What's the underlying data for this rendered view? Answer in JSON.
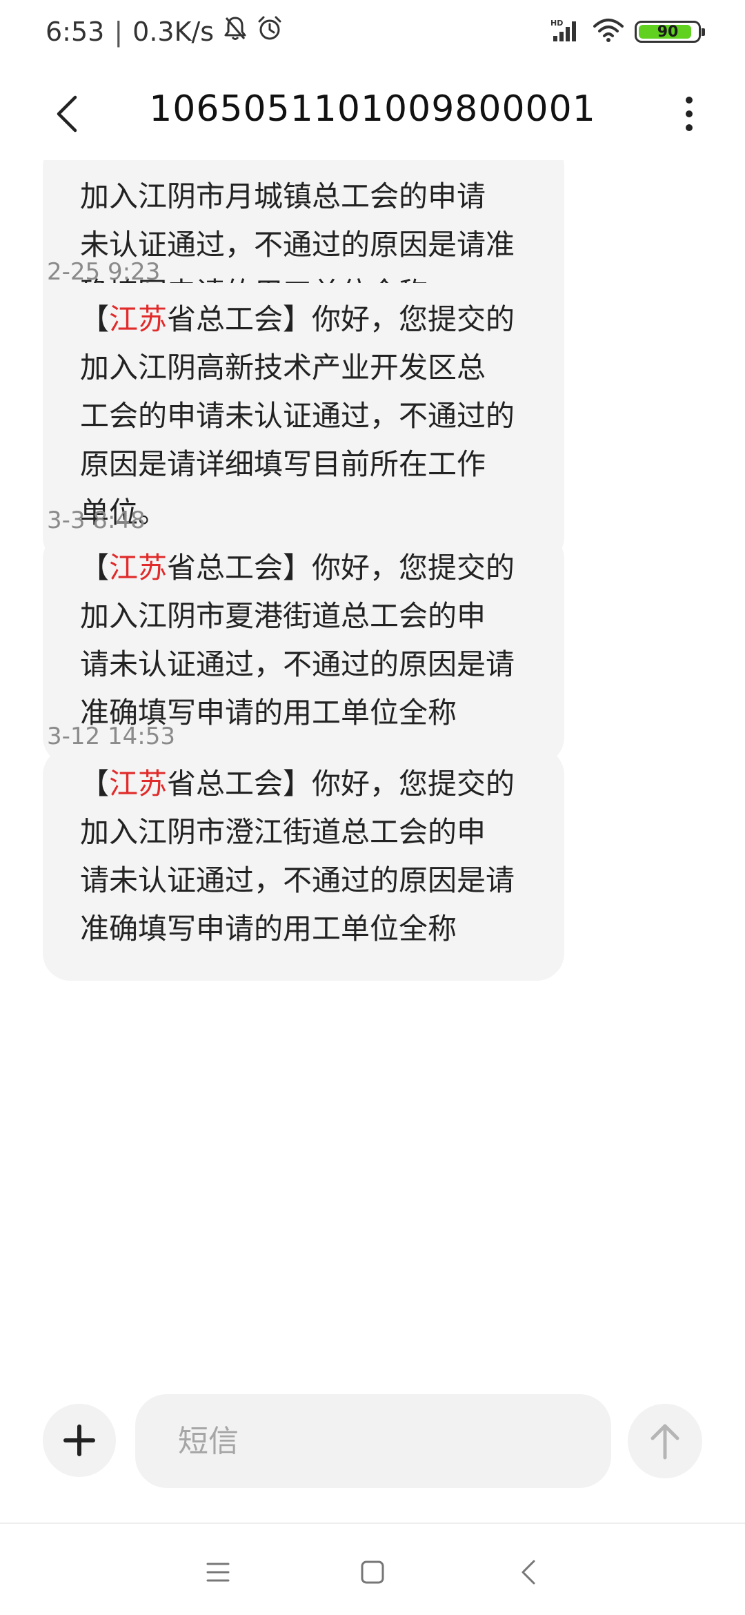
{
  "status_bar": {
    "time": "6:53",
    "separator": "|",
    "net_speed": "0.3K/s",
    "icons": [
      "bell-off-icon",
      "alarm-icon",
      "hd-signal-icon",
      "wifi-icon",
      "battery-icon"
    ],
    "network_badge": "HD",
    "battery": {
      "level": 90,
      "label": "90",
      "color": "#5fd11e"
    }
  },
  "header": {
    "back_icon": "chevron-left-icon",
    "title": "1065051101009800001",
    "more_icon": "more-vertical-icon"
  },
  "colors": {
    "bubble_bg": "#f4f4f4",
    "highlight": "#e12a2a",
    "timestamp": "#8a8a8a"
  },
  "messages": [
    {
      "timestamp": "",
      "lines": [
        [
          {
            "t": "加入江阴市月城镇总工会的申请"
          }
        ],
        [
          {
            "t": "未认证通过，不通过的原因是请准"
          }
        ],
        [
          {
            "t": "确填写申请的用工单位全称"
          }
        ]
      ]
    },
    {
      "timestamp": "2-25 9:23",
      "lines": [
        [
          {
            "t": "【"
          },
          {
            "t": "江苏",
            "hl": true
          },
          {
            "t": "省总工会】你好，您提交的"
          }
        ],
        [
          {
            "t": "加入江阴高新技术产业开发区总"
          }
        ],
        [
          {
            "t": "工会的申请未认证通过，不通过的"
          }
        ],
        [
          {
            "t": "原因是请详细填写目前所在工作"
          }
        ],
        [
          {
            "t": "单位。"
          }
        ]
      ]
    },
    {
      "timestamp": "3-3 8:48",
      "lines": [
        [
          {
            "t": "【"
          },
          {
            "t": "江苏",
            "hl": true
          },
          {
            "t": "省总工会】你好，您提交的"
          }
        ],
        [
          {
            "t": "加入江阴市夏港街道总工会的申"
          }
        ],
        [
          {
            "t": "请未认证通过，不通过的原因是请"
          }
        ],
        [
          {
            "t": "准确填写申请的用工单位全称"
          }
        ]
      ]
    },
    {
      "timestamp": "3-12 14:53",
      "lines": [
        [
          {
            "t": "【"
          },
          {
            "t": "江苏",
            "hl": true
          },
          {
            "t": "省总工会】你好，您提交的"
          }
        ],
        [
          {
            "t": "加入江阴市澄江街道总工会的申"
          }
        ],
        [
          {
            "t": "请未认证通过，不通过的原因是请"
          }
        ],
        [
          {
            "t": "准确填写申请的用工单位全称"
          }
        ]
      ]
    }
  ],
  "composer": {
    "add_icon": "plus-icon",
    "placeholder": "短信",
    "value": "",
    "send_icon": "arrow-up-icon"
  },
  "nav_bar": {
    "icons": [
      "menu-icon",
      "home-square-icon",
      "back-triangle-icon"
    ]
  }
}
